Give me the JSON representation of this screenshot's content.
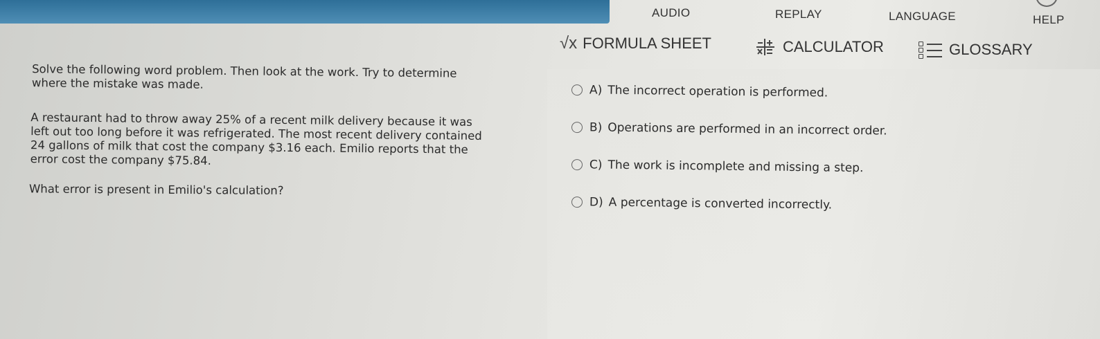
{
  "header": {
    "audio": "AUDIO",
    "replay": "REPLAY",
    "language": "LANGUAGE",
    "help": "HELP"
  },
  "toolbar": {
    "formula_label": "FORMULA SHEET",
    "calculator_label": "CALCULATOR",
    "glossary_label": "GLOSSARY"
  },
  "question": {
    "intro_line1": "Solve the following word problem. Then look at the work. Try to determine",
    "intro_line2": "where the mistake was made.",
    "problem_line1": "A restaurant had to throw away 25% of a recent milk delivery because it was",
    "problem_line2": "left out too long before it was refrigerated. The most recent delivery contained",
    "problem_line3": "24 gallons of milk that cost the company $3.16 each. Emilio reports that the",
    "problem_line4": "error cost the company $75.84.",
    "prompt": "What error is present in Emilio's calculation?"
  },
  "choices": [
    {
      "letter": "A)",
      "text": "The incorrect operation is performed."
    },
    {
      "letter": "B)",
      "text": "Operations are performed in an incorrect order."
    },
    {
      "letter": "C)",
      "text": "The work is incomplete and missing a step."
    },
    {
      "letter": "D)",
      "text": "A percentage is converted incorrectly."
    }
  ],
  "icons": {
    "formula": "square-root-icon",
    "calculator": "calculator-icon",
    "glossary": "list-icon"
  },
  "colors": {
    "accent_blue": "#2e6f98",
    "text": "#2b2b2b"
  }
}
